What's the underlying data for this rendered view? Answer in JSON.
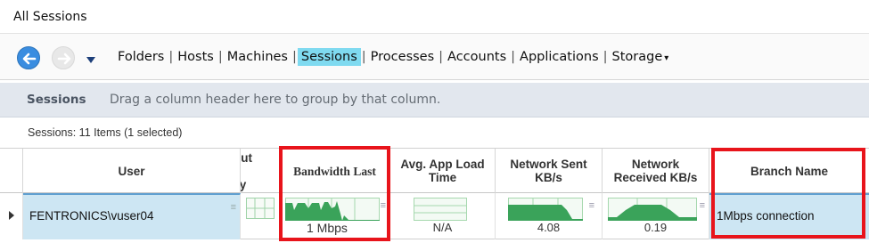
{
  "window": {
    "title": "All Sessions"
  },
  "navbar": {
    "back_icon": "arrow-left-icon",
    "forward_icon": "arrow-right-icon",
    "dropdown_icon": "triangle-down-icon",
    "links": [
      "Folders",
      "Hosts",
      "Machines",
      "Sessions",
      "Processes",
      "Accounts",
      "Applications",
      "Storage"
    ],
    "active": "Sessions",
    "storage_caret": "▾",
    "accent_color": "#7fdaf0"
  },
  "groupbar": {
    "title": "Sessions",
    "hint": "Drag a column header here to group by that column."
  },
  "status": {
    "count_text": "Sessions: 11 Items (1 selected)"
  },
  "table": {
    "columns": {
      "user": "User",
      "partial_line1": "out",
      "partial_line2": "y",
      "bandwidth": "Bandwidth Last",
      "avg_line1": "Avg. App Load",
      "avg_line2": "Time",
      "sent_line1": "Network Sent",
      "sent_line2": "KB/s",
      "recv_line1": "Network",
      "recv_line2": "Received KB/s",
      "branch": "Branch Name"
    },
    "row": {
      "user": "FENTRONICS\\vuser04",
      "bandwidth": "1 Mbps",
      "avg_app_load": "N/A",
      "network_sent": "4.08",
      "network_received": "0.19",
      "branch": "1Mbps connection"
    },
    "selection_color": "#cde6f3",
    "spark_color": "#3aa35a"
  },
  "highlight_color": "#e8141b"
}
